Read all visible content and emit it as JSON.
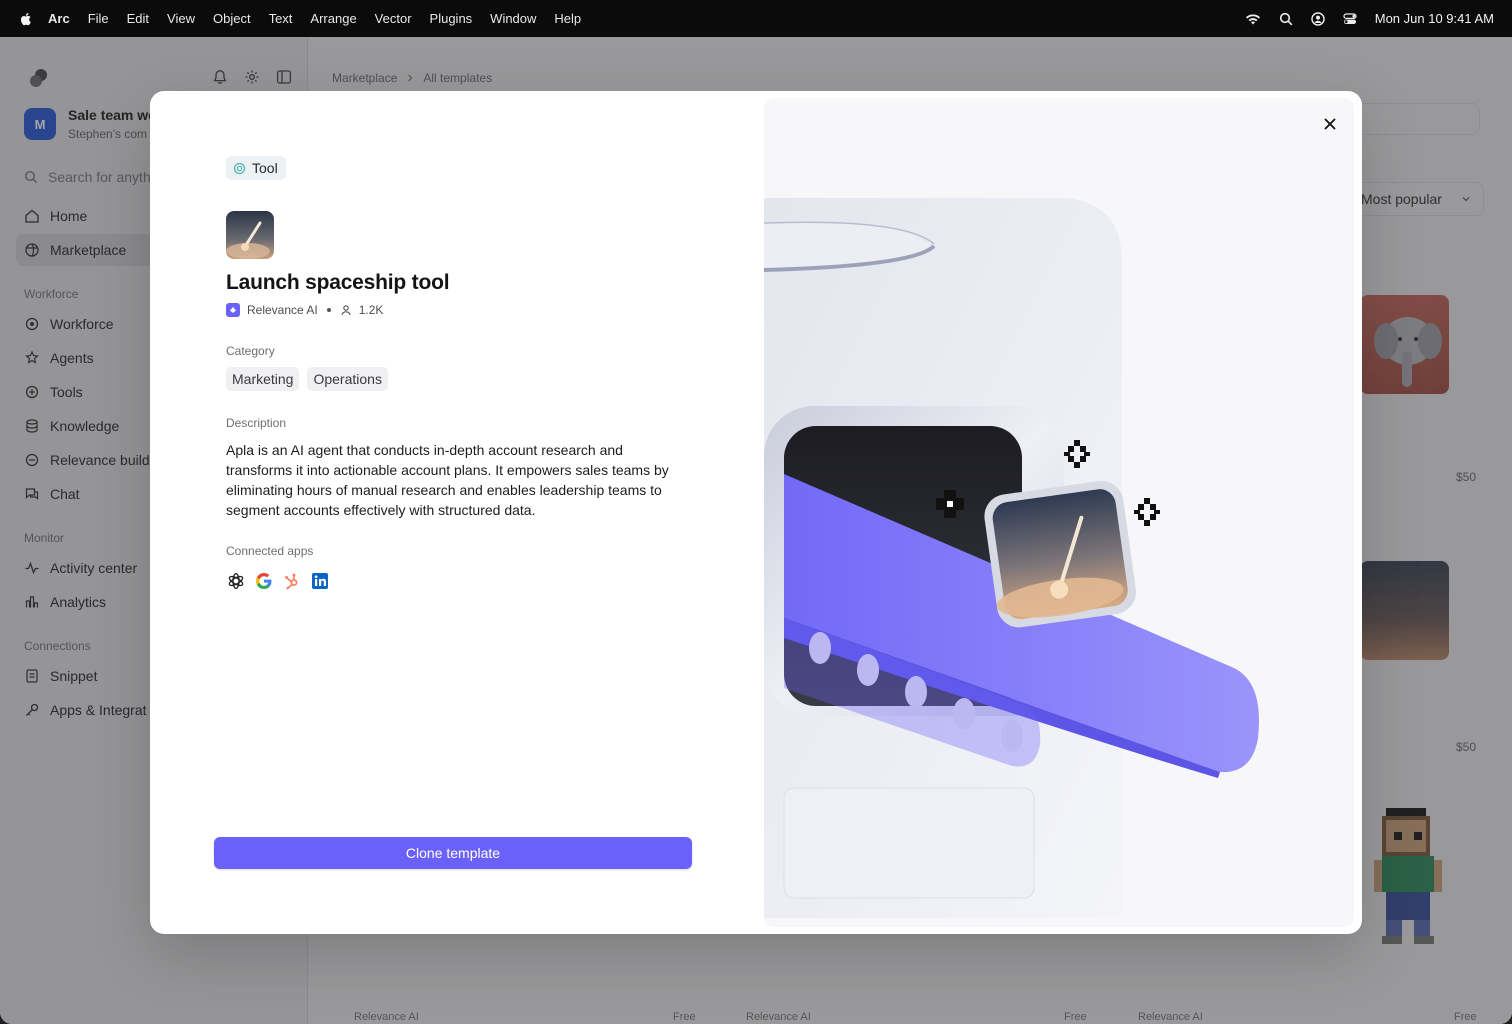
{
  "menubar": {
    "app_name": "Arc",
    "menus": [
      "File",
      "Edit",
      "View",
      "Object",
      "Text",
      "Arrange",
      "Vector",
      "Plugins",
      "Window",
      "Help"
    ],
    "datetime": "Mon Jun 10  9:41 AM"
  },
  "sidebar": {
    "workspace_name": "Sale team wo",
    "workspace_sub": "Stephen's com",
    "search_placeholder": "Search for anyth",
    "nav": [
      {
        "label": "Home",
        "icon": "home-icon"
      },
      {
        "label": "Marketplace",
        "icon": "marketplace-icon",
        "active": true
      }
    ],
    "sections": [
      {
        "title": "Workforce",
        "items": [
          "Workforce",
          "Agents",
          "Tools",
          "Knowledge",
          "Relevance build",
          "Chat"
        ]
      },
      {
        "title": "Monitor",
        "items": [
          "Activity center",
          "Analytics"
        ]
      },
      {
        "title": "Connections",
        "items": [
          "Snippet",
          "Apps & Integrat"
        ]
      }
    ]
  },
  "main": {
    "breadcrumb": [
      "Marketplace",
      "All templates"
    ],
    "sort_label": "Most popular",
    "prices": [
      "$50",
      "$50"
    ],
    "card_footers": [
      {
        "author": "Relevance AI",
        "price": "Free"
      },
      {
        "author": "Relevance AI",
        "price": "Free"
      },
      {
        "author": "Relevance AI",
        "price": "Free"
      }
    ]
  },
  "modal": {
    "type_label": "Tool",
    "title": "Launch spaceship tool",
    "author": "Relevance AI",
    "users": "1.2K",
    "category_label": "Category",
    "categories": [
      "Marketing",
      "Operations"
    ],
    "description_label": "Description",
    "description": "Apla is an AI agent that conducts in-depth account research and transforms it into actionable account plans. It empowers sales teams by eliminating hours of manual research and enables leadership teams to segment accounts effectively with structured data.",
    "connected_apps_label": "Connected apps",
    "connected_apps": [
      "openai-icon",
      "google-icon",
      "hubspot-icon",
      "linkedin-icon"
    ],
    "clone_button": "Clone template",
    "colors": {
      "accent": "#6a62f8",
      "belt": "#7b74fb"
    }
  }
}
